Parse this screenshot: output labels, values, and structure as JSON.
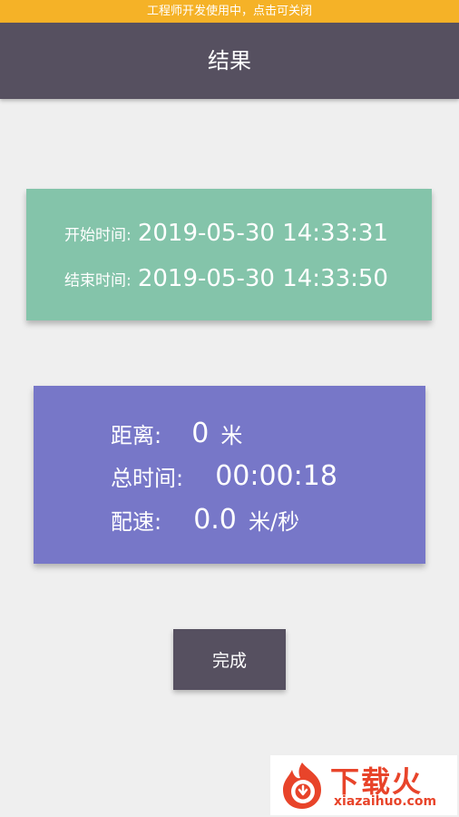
{
  "dev_banner": {
    "text": "工程师开发使用中，点击可关闭"
  },
  "header": {
    "title": "结果"
  },
  "time_card": {
    "start_label": "开始时间:",
    "start_value": "2019-05-30 14:33:31",
    "end_label": "结束时间:",
    "end_value": "2019-05-30 14:33:50"
  },
  "stats": {
    "distance_label": "距离:",
    "distance_value": "0",
    "distance_unit": "米",
    "total_time_label": "总时间:",
    "total_time_value": "00:00:18",
    "pace_label": "配速:",
    "pace_value": "0.0",
    "pace_unit": "米/秒"
  },
  "actions": {
    "done_label": "完成"
  },
  "watermark": {
    "title": "下载火",
    "domain": "xiazaihuo.com"
  },
  "colors": {
    "banner": "#f5b227",
    "app_bar": "#565060",
    "time_card": "#84c4aa",
    "stats_card": "#7777c8",
    "button": "#565060",
    "background": "#efefef",
    "watermark": "#e8442a"
  }
}
